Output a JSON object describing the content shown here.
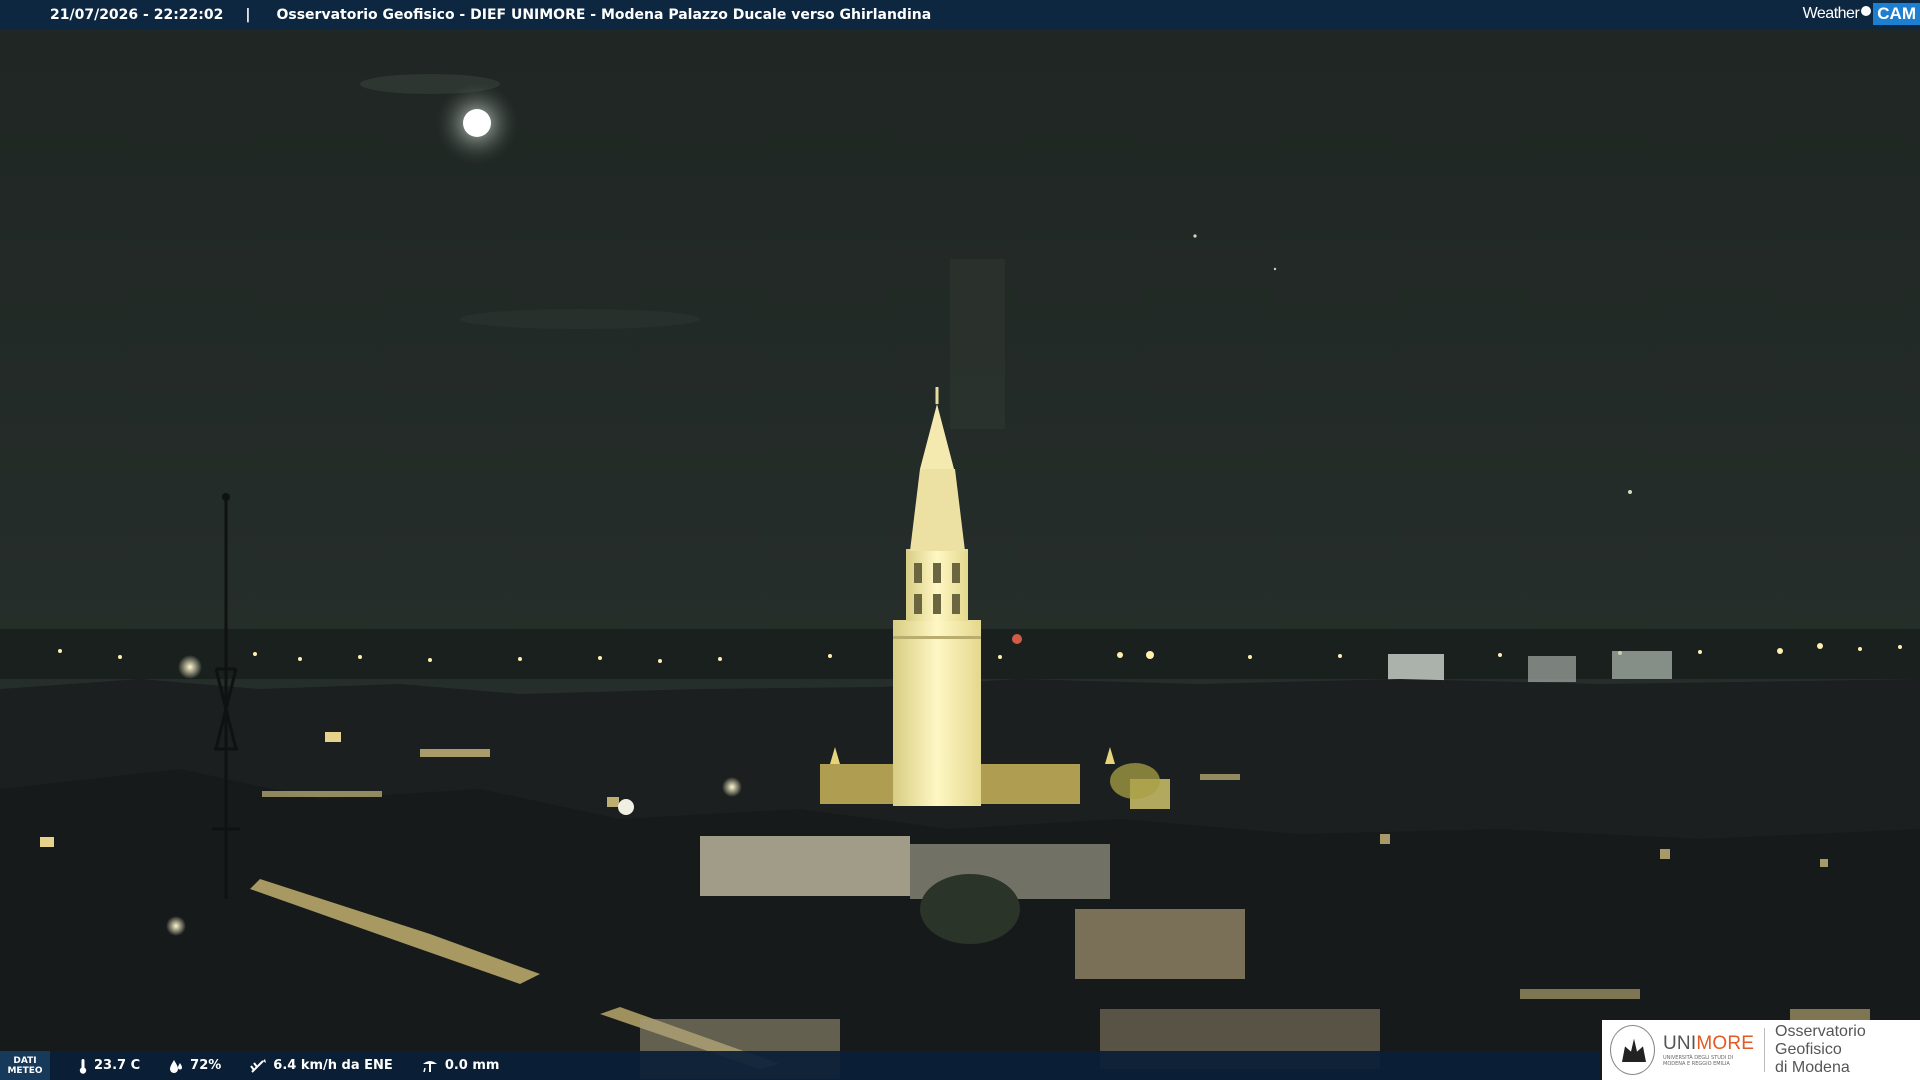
{
  "header": {
    "timestamp": "21/07/2026 - 22:22:02",
    "separator": "|",
    "location": "Osservatorio Geofisico - DIEF UNIMORE - Modena Palazzo Ducale verso Ghirlandina",
    "brand_weather": "Weather",
    "brand_cam": "CAM"
  },
  "weather": {
    "dati_line1": "DATI",
    "dati_line2": "METEO",
    "temperature": "23.7 C",
    "humidity": "72%",
    "wind": "6.4 km/h da ENE",
    "rain": "0.0 mm",
    "icons": [
      "thermometer-icon",
      "humidity-icon",
      "wind-icon",
      "rain-gauge-icon"
    ]
  },
  "logo": {
    "unimore_a": "UNI",
    "unimore_b": "MORE",
    "subtitle_1": "UNIVERSITÀ DEGLI STUDI DI",
    "subtitle_2": "MODENA E REGGIO EMILIA",
    "observatory_1": "Osservatorio Geofisico",
    "observatory_2": "di Modena"
  },
  "colors": {
    "topbar": "#0d2740",
    "bottombar": "#0a1e37",
    "cam_blue": "#1e7fd0",
    "unimore_orange": "#e25a24",
    "sky": "#232b27",
    "tower_light": "#fff5c0"
  }
}
